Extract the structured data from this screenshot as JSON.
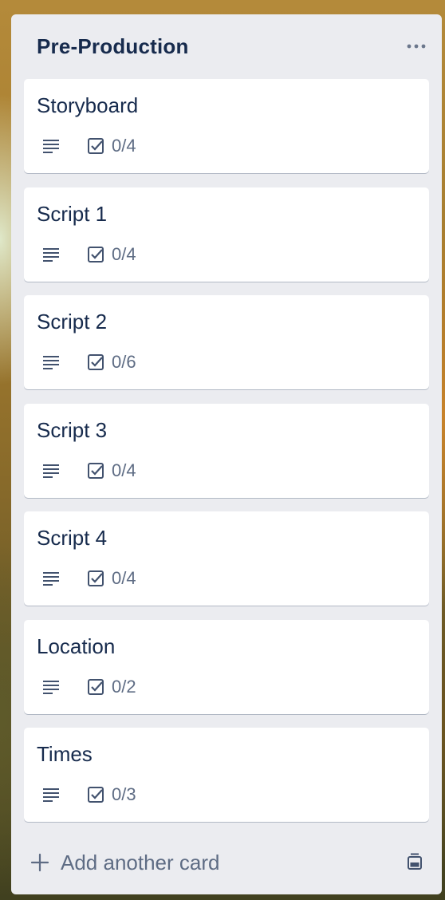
{
  "list": {
    "title": "Pre-Production",
    "menu_icon": "more-horizontal-icon",
    "cards": [
      {
        "title": "Storyboard",
        "checklist": "0/4"
      },
      {
        "title": "Script 1",
        "checklist": "0/4"
      },
      {
        "title": "Script 2",
        "checklist": "0/6"
      },
      {
        "title": "Script 3",
        "checklist": "0/4"
      },
      {
        "title": "Script 4",
        "checklist": "0/4"
      },
      {
        "title": "Location",
        "checklist": "0/2"
      },
      {
        "title": "Times",
        "checklist": "0/3"
      }
    ],
    "footer": {
      "add_label": "Add another card",
      "add_icon": "plus-icon",
      "template_icon": "card-template-icon"
    }
  },
  "colors": {
    "list_bg": "#ebecf0",
    "card_bg": "#ffffff",
    "title_text": "#172b4d",
    "muted_text": "#5e6c84"
  }
}
